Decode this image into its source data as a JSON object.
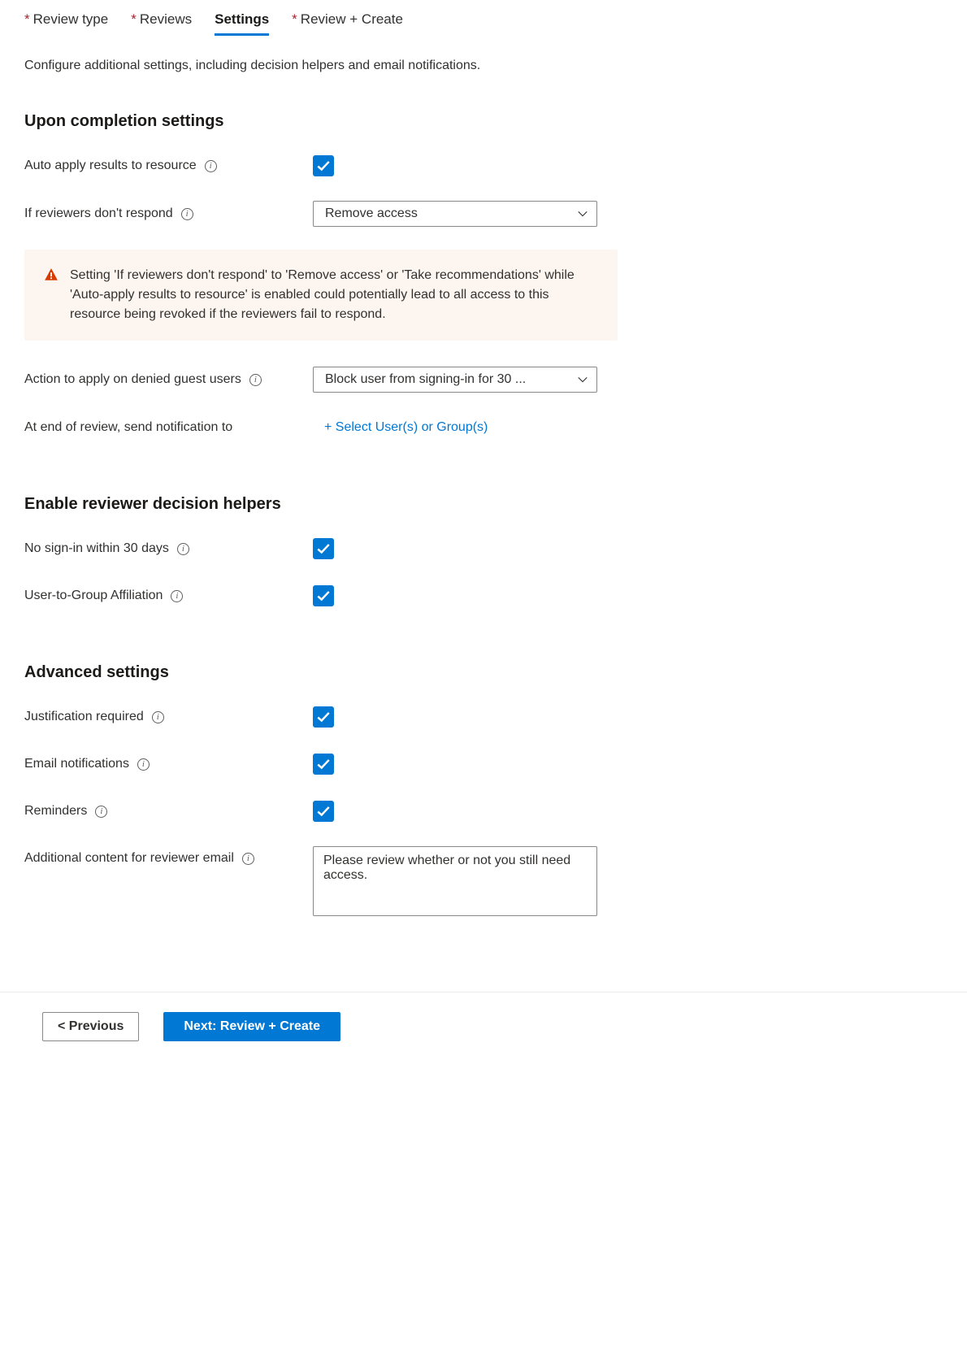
{
  "tabs": [
    {
      "label": "Review type",
      "required": true,
      "active": false
    },
    {
      "label": "Reviews",
      "required": true,
      "active": false
    },
    {
      "label": "Settings",
      "required": false,
      "active": true
    },
    {
      "label": "Review + Create",
      "required": true,
      "active": false
    }
  ],
  "description": "Configure additional settings, including decision helpers and email notifications.",
  "sections": {
    "completion": {
      "title": "Upon completion settings",
      "auto_apply_label": "Auto apply results to resource",
      "auto_apply_checked": true,
      "no_respond_label": "If reviewers don't respond",
      "no_respond_value": "Remove access",
      "warning_text": "Setting 'If reviewers don't respond' to 'Remove access' or 'Take recommendations' while 'Auto-apply results to resource' is enabled could potentially lead to all access to this resource being revoked if the reviewers fail to respond.",
      "denied_guest_label": "Action to apply on denied guest users",
      "denied_guest_value": "Block user from signing-in for 30 ...",
      "notify_label": "At end of review, send notification to",
      "notify_action": "+ Select User(s) or Group(s)"
    },
    "helpers": {
      "title": "Enable reviewer decision helpers",
      "no_signin_label": "No sign-in within 30 days",
      "no_signin_checked": true,
      "affiliation_label": "User-to-Group Affiliation",
      "affiliation_checked": true
    },
    "advanced": {
      "title": "Advanced settings",
      "justification_label": "Justification required",
      "justification_checked": true,
      "email_notif_label": "Email notifications",
      "email_notif_checked": true,
      "reminders_label": "Reminders",
      "reminders_checked": true,
      "additional_content_label": "Additional content for reviewer email",
      "additional_content_value": "Please review whether or not you still need access."
    }
  },
  "footer": {
    "previous_label": "< Previous",
    "next_label": "Next: Review + Create"
  }
}
